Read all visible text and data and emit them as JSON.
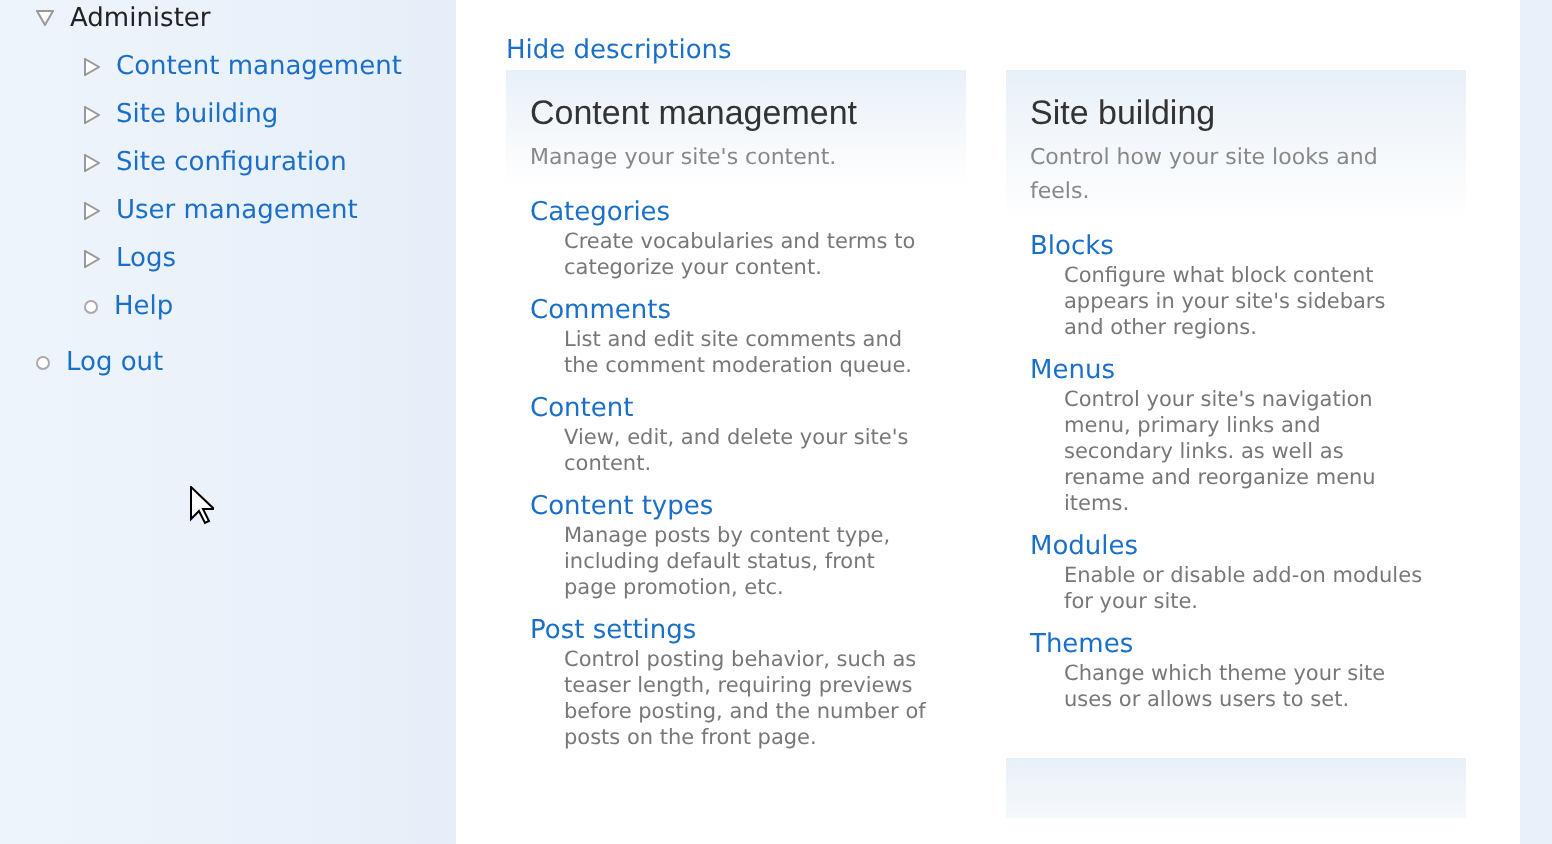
{
  "sidebar": {
    "items": [
      {
        "label": "Administer",
        "kind": "expanded",
        "children": [
          {
            "label": "Content management",
            "kind": "collapsed"
          },
          {
            "label": "Site building",
            "kind": "collapsed"
          },
          {
            "label": "Site configuration",
            "kind": "collapsed"
          },
          {
            "label": "User management",
            "kind": "collapsed"
          },
          {
            "label": "Logs",
            "kind": "collapsed"
          },
          {
            "label": "Help",
            "kind": "leaf"
          }
        ]
      },
      {
        "label": "Log out",
        "kind": "leaf"
      }
    ]
  },
  "toggle_link": "Hide descriptions",
  "columns": [
    [
      {
        "title": "Content management",
        "description": "Manage your site's content.",
        "links": [
          {
            "label": "Categories",
            "description": "Create vocabularies and terms to categorize your content."
          },
          {
            "label": "Comments",
            "description": "List and edit site comments and the comment moderation queue."
          },
          {
            "label": "Content",
            "description": "View, edit, and delete your site's content."
          },
          {
            "label": "Content types",
            "description": "Manage posts by content type, including default status, front page promotion, etc."
          },
          {
            "label": "Post settings",
            "description": "Control posting behavior, such as teaser length, requiring previews before posting, and the number of posts on the front page."
          }
        ]
      }
    ],
    [
      {
        "title": "Site building",
        "description": "Control how your site looks and feels.",
        "links": [
          {
            "label": "Blocks",
            "description": "Configure what block content appears in your site's sidebars and other regions."
          },
          {
            "label": "Menus",
            "description": "Control your site's navigation menu, primary links and secondary links. as well as rename and reorganize menu items."
          },
          {
            "label": "Modules",
            "description": "Enable or disable add-on modules for your site."
          },
          {
            "label": "Themes",
            "description": "Change which theme your site uses or allows users to set."
          }
        ]
      },
      {
        "kind": "cut"
      }
    ]
  ]
}
